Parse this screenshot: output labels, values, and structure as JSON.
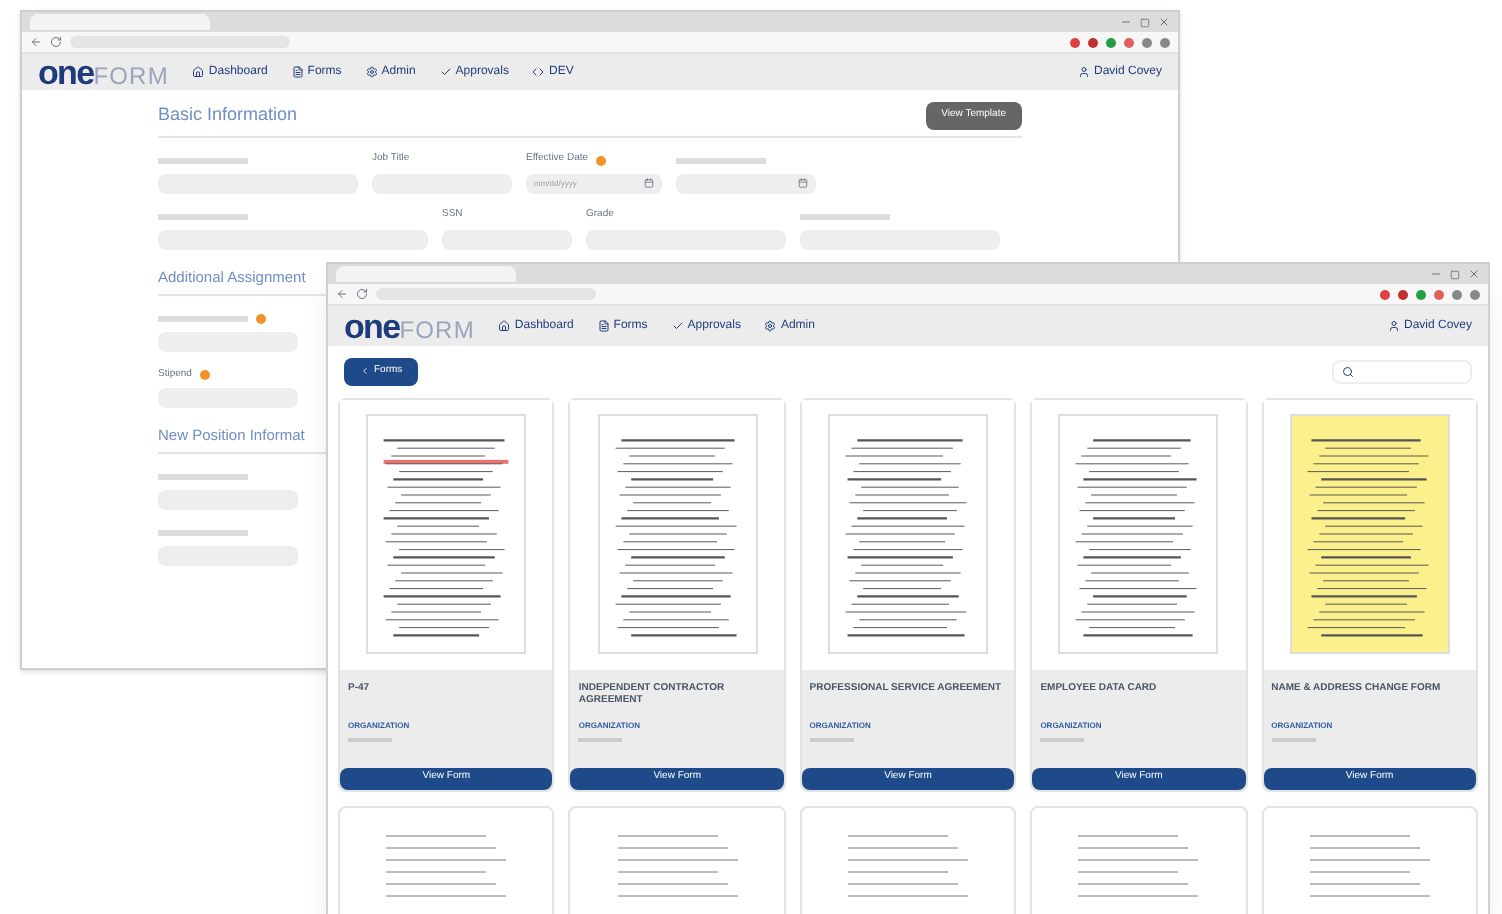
{
  "back_window": {
    "logo": {
      "first": "one",
      "second": "FORM"
    },
    "nav": [
      "Dashboard",
      "Forms",
      "Admin",
      "Approvals",
      "DEV"
    ],
    "user": "David Covey",
    "template_button": "View Template",
    "sections": [
      {
        "title": "Basic Information",
        "rows": [
          [
            {
              "kind": "text"
            },
            {
              "kind": "text",
              "label": "Job Title"
            },
            {
              "kind": "date",
              "label": "Effective Date",
              "required": true,
              "placeholder": "mm/dd/yyyy"
            },
            {
              "kind": "date"
            }
          ],
          [
            {
              "kind": "text"
            },
            {
              "kind": "text",
              "label": "SSN"
            },
            {
              "kind": "text",
              "label": "Grade"
            },
            {
              "kind": "text"
            }
          ]
        ]
      },
      {
        "title": "Additional Assignment",
        "rows": [
          [
            {
              "kind": "text",
              "required": true
            }
          ],
          [
            {
              "kind": "text",
              "label": "Stipend",
              "required": true
            }
          ]
        ]
      },
      {
        "title": "New Position Informat",
        "rows": [
          [
            {
              "kind": "text"
            }
          ],
          [
            {
              "kind": "text"
            }
          ]
        ]
      }
    ]
  },
  "front_window": {
    "logo": {
      "first": "one",
      "second": "FORM"
    },
    "nav": [
      "Dashboard",
      "Forms",
      "Approvals",
      "Admin"
    ],
    "user": "David Covey",
    "back_button": "Forms",
    "cards": [
      {
        "title": "P-47",
        "org_label": "ORGANIZATION",
        "button": "View Form",
        "color": "#ffffff"
      },
      {
        "title": "INDEPENDENT CONTRACTOR AGREEMENT",
        "org_label": "ORGANIZATION",
        "button": "View Form",
        "color": "#ffffff"
      },
      {
        "title": "PROFESSIONAL SERVICE AGREEMENT",
        "org_label": "ORGANIZATION",
        "button": "View Form",
        "color": "#ffffff"
      },
      {
        "title": "EMPLOYEE DATA CARD",
        "org_label": "ORGANIZATION",
        "button": "View Form",
        "color": "#ffffff"
      },
      {
        "title": "NAME & ADDRESS CHANGE FORM",
        "org_label": "ORGANIZATION",
        "button": "View Form",
        "color": "#fbf08c"
      }
    ]
  }
}
